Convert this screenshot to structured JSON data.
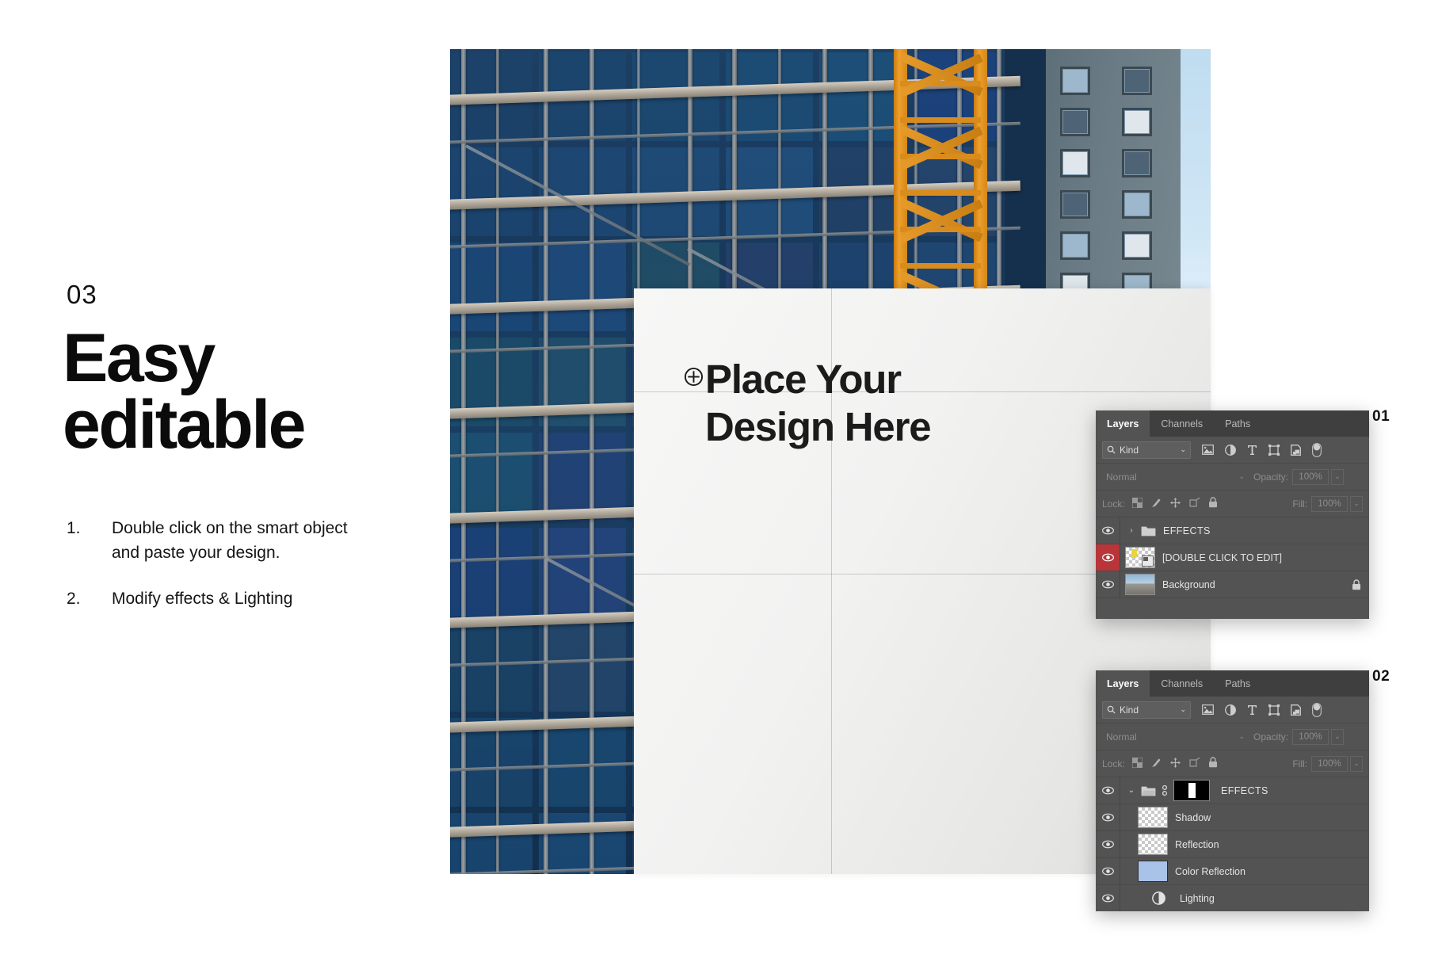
{
  "left_block": {
    "step_number": "03",
    "headline_line1": "Easy",
    "headline_line2": "editable",
    "bullets": [
      {
        "marker": "1.",
        "text": "Double click on the smart object and paste your design."
      },
      {
        "marker": "2.",
        "text": "Modify effects & Lighting"
      }
    ]
  },
  "billboard": {
    "placeholder_line1": "Place Your",
    "placeholder_line2": "Design Here",
    "plus_icon": "crosshair-plus-icon"
  },
  "panels": [
    {
      "badge": "01",
      "tabs": [
        {
          "label": "Layers",
          "active": true
        },
        {
          "label": "Channels",
          "active": false
        },
        {
          "label": "Paths",
          "active": false
        }
      ],
      "filter": {
        "kind_label": "Kind",
        "search_icon": "search-icon",
        "chevron": "⌄",
        "icons": [
          "pixel-layer-filter-icon",
          "adjustment-layer-filter-icon",
          "type-layer-filter-icon",
          "shape-layer-filter-icon",
          "smart-object-filter-icon",
          "filter-toggle-switch-icon"
        ]
      },
      "blend": {
        "mode": "Normal",
        "opacity_label": "Opacity:",
        "opacity_value": "100%"
      },
      "lock": {
        "label": "Lock:",
        "icons": [
          "lock-transparent-pixels-icon",
          "lock-image-pixels-icon",
          "lock-position-icon",
          "lock-artboard-nesting-icon",
          "lock-all-icon"
        ],
        "fill_label": "Fill:",
        "fill_value": "100%"
      },
      "layers": [
        {
          "name": "EFFECTS",
          "type": "group",
          "visible": true,
          "twirl": "›",
          "selected": false,
          "locked": false,
          "thumb": "folder"
        },
        {
          "name": "[DOUBLE CLICK TO EDIT]",
          "type": "smart-object",
          "visible": true,
          "selected": true,
          "locked": false,
          "thumb": "smart-object"
        },
        {
          "name": "Background",
          "type": "image",
          "visible": true,
          "selected": false,
          "locked": true,
          "thumb": "photo"
        }
      ]
    },
    {
      "badge": "02",
      "tabs": [
        {
          "label": "Layers",
          "active": true
        },
        {
          "label": "Channels",
          "active": false
        },
        {
          "label": "Paths",
          "active": false
        }
      ],
      "filter": {
        "kind_label": "Kind",
        "search_icon": "search-icon",
        "chevron": "⌄",
        "icons": [
          "pixel-layer-filter-icon",
          "adjustment-layer-filter-icon",
          "type-layer-filter-icon",
          "shape-layer-filter-icon",
          "smart-object-filter-icon",
          "filter-toggle-switch-icon"
        ]
      },
      "blend": {
        "mode": "Normal",
        "opacity_label": "Opacity:",
        "opacity_value": "100%"
      },
      "lock": {
        "label": "Lock:",
        "icons": [
          "lock-transparent-pixels-icon",
          "lock-image-pixels-icon",
          "lock-position-icon",
          "lock-artboard-nesting-icon",
          "lock-all-icon"
        ],
        "fill_label": "Fill:",
        "fill_value": "100%"
      },
      "layers": [
        {
          "name": "EFFECTS",
          "type": "group-expanded",
          "visible": true,
          "twirl": "⌄",
          "selected": false,
          "locked": false,
          "thumb": "folder-mask"
        },
        {
          "name": "Shadow",
          "type": "pixel",
          "visible": true,
          "selected": false,
          "locked": false,
          "thumb": "transparent"
        },
        {
          "name": "Reflection",
          "type": "pixel",
          "visible": true,
          "selected": false,
          "locked": false,
          "thumb": "transparent"
        },
        {
          "name": "Color Reflection",
          "type": "pixel",
          "visible": true,
          "selected": false,
          "locked": false,
          "thumb": "solid-blue"
        },
        {
          "name": "Lighting",
          "type": "adjustment",
          "visible": true,
          "selected": false,
          "locked": false,
          "thumb": "adjustment"
        }
      ]
    }
  ],
  "colors": {
    "panel_bg": "#535353",
    "panel_tabbar": "#3f3f3f",
    "selected_eye_red": "#b8353a",
    "color_reflection_swatch": "#a8c2e8",
    "crane_orange": "#e0901f",
    "scaffold_blue": "#1b3f63",
    "text_black": "#111111"
  }
}
